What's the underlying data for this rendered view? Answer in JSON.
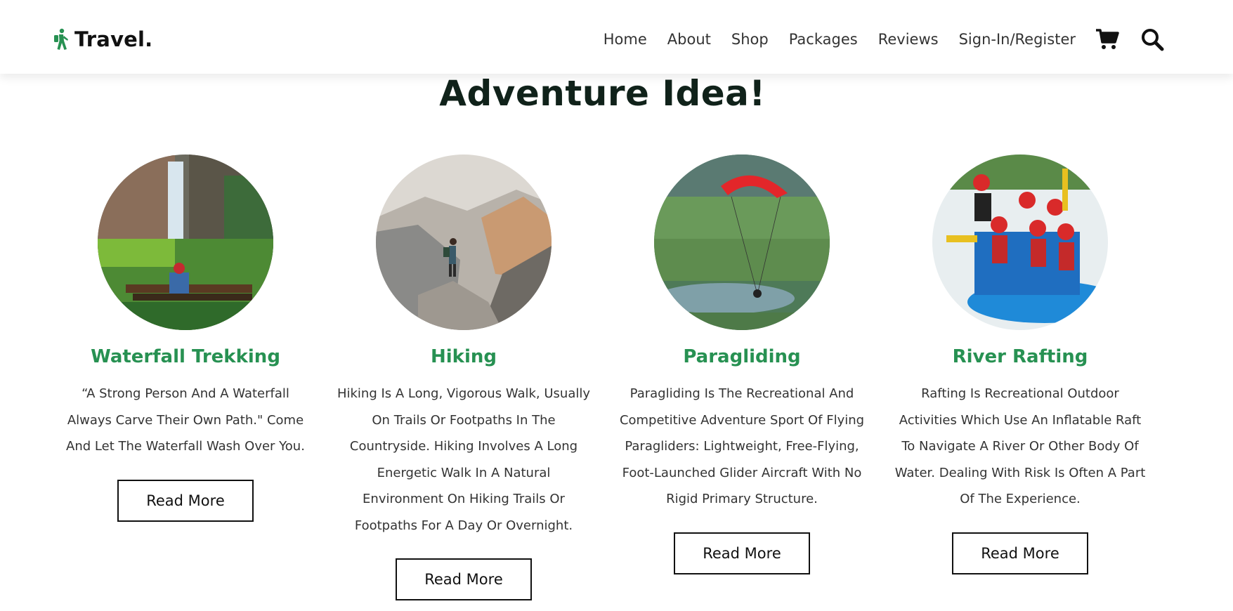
{
  "header": {
    "logo_text": "Travel.",
    "nav": [
      "Home",
      "About",
      "Shop",
      "Packages",
      "Reviews",
      "Sign-In/Register"
    ],
    "icons": [
      "shopping-cart-icon",
      "search-icon"
    ],
    "accent_color": "#279152"
  },
  "section": {
    "title": "Adventure Idea!"
  },
  "cards": [
    {
      "title": "Waterfall Trekking",
      "description": "“A Strong Person And A Waterfall Always Carve Their Own Path.\" Come And Let The Waterfall Wash Over You.",
      "button": "Read More"
    },
    {
      "title": "Hiking",
      "description": "Hiking Is A Long, Vigorous Walk, Usually On Trails Or Footpaths In The Countryside. Hiking Involves A Long Energetic Walk In A Natural Environment On Hiking Trails Or Footpaths For A Day Or Overnight.",
      "button": "Read More"
    },
    {
      "title": "Paragliding",
      "description": "Paragliding Is The Recreational And Competitive Adventure Sport Of Flying Paragliders: Lightweight, Free-Flying, Foot-Launched Glider Aircraft With No Rigid Primary Structure.",
      "button": "Read More"
    },
    {
      "title": "River Rafting",
      "description": "Rafting Is Recreational Outdoor Activities Which Use An Inflatable Raft To Navigate A River Or Other Body Of Water. Dealing With Risk Is Often A Part Of The Experience.",
      "button": "Read More"
    }
  ]
}
